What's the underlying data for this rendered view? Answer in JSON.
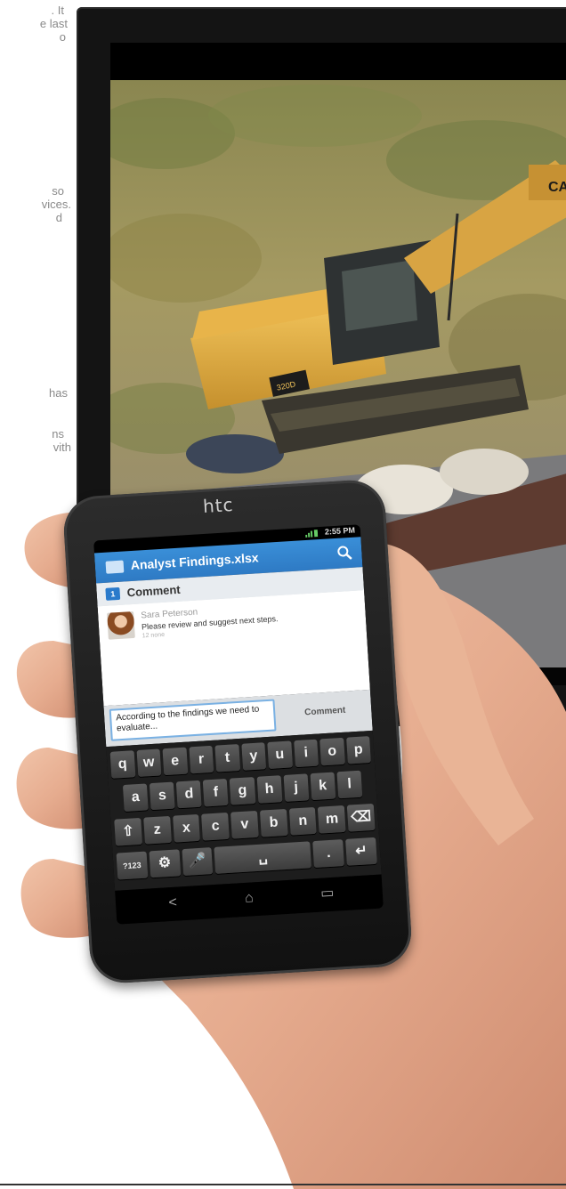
{
  "background_text": {
    "fragments": [
      ". It",
      "e last",
      "o",
      "so",
      "vices.",
      "d",
      "has",
      "ns",
      "vith"
    ]
  },
  "phone": {
    "brand": "htc",
    "status_time": "2:55 PM",
    "file_title": "Analyst Findings.xlsx",
    "section_label": "Comment",
    "section_badge": "1",
    "comment": {
      "author": "Sara Peterson",
      "message": "Please review and suggest next steps.",
      "ago": "12 none"
    },
    "input_value": "According to the findings we need to evaluate...",
    "comment_button": "Comment",
    "keyboard": {
      "row1": [
        "q",
        "w",
        "e",
        "r",
        "t",
        "y",
        "u",
        "i",
        "o",
        "p"
      ],
      "row2": [
        "a",
        "s",
        "d",
        "f",
        "g",
        "h",
        "j",
        "k",
        "l"
      ],
      "row3": [
        "⇧",
        "z",
        "x",
        "c",
        "v",
        "b",
        "n",
        "m",
        "⌫"
      ],
      "row4": [
        "?123",
        "⚙",
        "🎤",
        "␣",
        ".",
        "↵"
      ]
    }
  },
  "icons": [
    "folder-icon",
    "search-icon",
    "signal-icon",
    "back-icon",
    "home-icon",
    "recent-apps-icon",
    "shift-icon",
    "backspace-icon",
    "settings-icon",
    "mic-icon",
    "enter-icon"
  ]
}
